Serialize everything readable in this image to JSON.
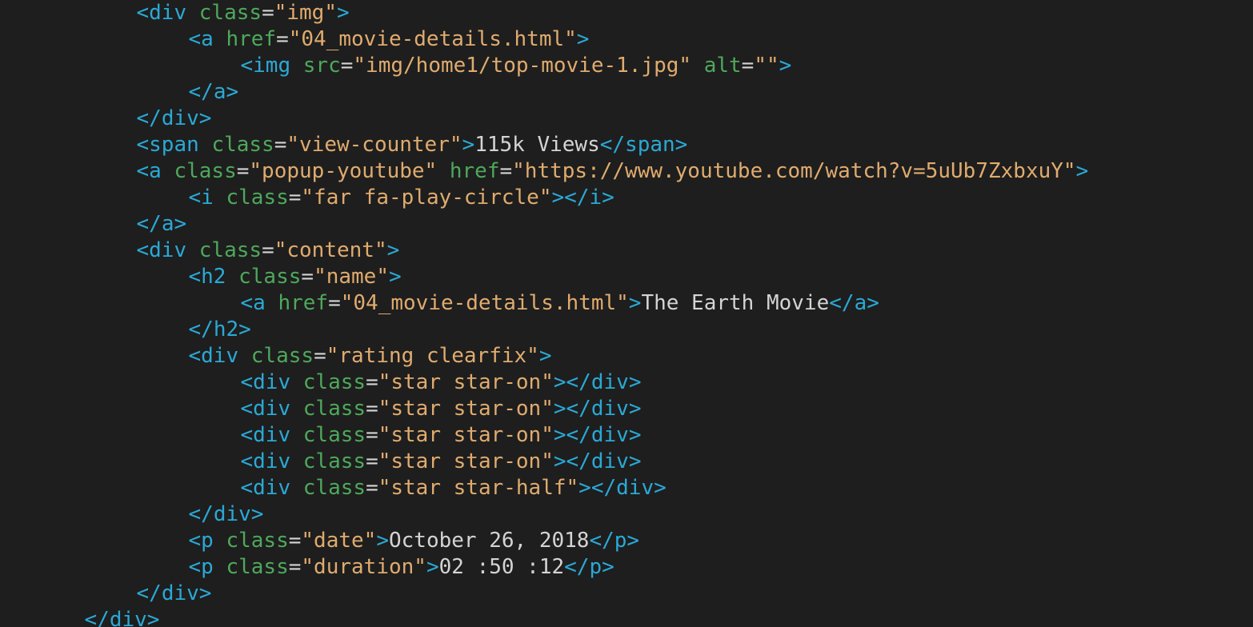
{
  "editor": {
    "lines": [
      {
        "indent": 5,
        "tokens": [
          {
            "t": "bracket",
            "v": "<"
          },
          {
            "t": "tag",
            "v": "div"
          },
          {
            "t": "text",
            "v": " "
          },
          {
            "t": "attr",
            "v": "class"
          },
          {
            "t": "eq",
            "v": "="
          },
          {
            "t": "str",
            "v": "\"img\""
          },
          {
            "t": "bracket",
            "v": ">"
          }
        ]
      },
      {
        "indent": 7,
        "tokens": [
          {
            "t": "bracket",
            "v": "<"
          },
          {
            "t": "tag",
            "v": "a"
          },
          {
            "t": "text",
            "v": " "
          },
          {
            "t": "attr",
            "v": "href"
          },
          {
            "t": "eq",
            "v": "="
          },
          {
            "t": "str",
            "v": "\"04_movie-details.html\""
          },
          {
            "t": "bracket",
            "v": ">"
          }
        ]
      },
      {
        "indent": 9,
        "tokens": [
          {
            "t": "bracket",
            "v": "<"
          },
          {
            "t": "tag",
            "v": "img"
          },
          {
            "t": "text",
            "v": " "
          },
          {
            "t": "attr",
            "v": "src"
          },
          {
            "t": "eq",
            "v": "="
          },
          {
            "t": "str",
            "v": "\"img/home1/top-movie-1.jpg\""
          },
          {
            "t": "text",
            "v": " "
          },
          {
            "t": "attr",
            "v": "alt"
          },
          {
            "t": "eq",
            "v": "="
          },
          {
            "t": "str",
            "v": "\"\""
          },
          {
            "t": "bracket",
            "v": ">"
          }
        ]
      },
      {
        "indent": 7,
        "tokens": [
          {
            "t": "bracket",
            "v": "</"
          },
          {
            "t": "tag",
            "v": "a"
          },
          {
            "t": "bracket",
            "v": ">"
          }
        ]
      },
      {
        "indent": 5,
        "tokens": [
          {
            "t": "bracket",
            "v": "</"
          },
          {
            "t": "tag",
            "v": "div"
          },
          {
            "t": "bracket",
            "v": ">"
          }
        ]
      },
      {
        "indent": 5,
        "tokens": [
          {
            "t": "bracket",
            "v": "<"
          },
          {
            "t": "tag",
            "v": "span"
          },
          {
            "t": "text",
            "v": " "
          },
          {
            "t": "attr",
            "v": "class"
          },
          {
            "t": "eq",
            "v": "="
          },
          {
            "t": "str",
            "v": "\"view-counter\""
          },
          {
            "t": "bracket",
            "v": ">"
          },
          {
            "t": "text",
            "v": "115k Views"
          },
          {
            "t": "bracket",
            "v": "</"
          },
          {
            "t": "tag",
            "v": "span"
          },
          {
            "t": "bracket",
            "v": ">"
          }
        ]
      },
      {
        "indent": 5,
        "tokens": [
          {
            "t": "bracket",
            "v": "<"
          },
          {
            "t": "tag",
            "v": "a"
          },
          {
            "t": "text",
            "v": " "
          },
          {
            "t": "attr",
            "v": "class"
          },
          {
            "t": "eq",
            "v": "="
          },
          {
            "t": "str",
            "v": "\"popup-youtube\""
          },
          {
            "t": "text",
            "v": " "
          },
          {
            "t": "attr",
            "v": "href"
          },
          {
            "t": "eq",
            "v": "="
          },
          {
            "t": "str",
            "v": "\"https://www.youtube.com/watch?v=5uUb7ZxbxuY\""
          },
          {
            "t": "bracket",
            "v": ">"
          }
        ]
      },
      {
        "indent": 7,
        "tokens": [
          {
            "t": "bracket",
            "v": "<"
          },
          {
            "t": "tag",
            "v": "i"
          },
          {
            "t": "text",
            "v": " "
          },
          {
            "t": "attr",
            "v": "class"
          },
          {
            "t": "eq",
            "v": "="
          },
          {
            "t": "str",
            "v": "\"far fa-play-circle\""
          },
          {
            "t": "bracket",
            "v": "></"
          },
          {
            "t": "tag",
            "v": "i"
          },
          {
            "t": "bracket",
            "v": ">"
          }
        ]
      },
      {
        "indent": 5,
        "tokens": [
          {
            "t": "bracket",
            "v": "</"
          },
          {
            "t": "tag",
            "v": "a"
          },
          {
            "t": "bracket",
            "v": ">"
          }
        ]
      },
      {
        "indent": 5,
        "tokens": [
          {
            "t": "bracket",
            "v": "<"
          },
          {
            "t": "tag",
            "v": "div"
          },
          {
            "t": "text",
            "v": " "
          },
          {
            "t": "attr",
            "v": "class"
          },
          {
            "t": "eq",
            "v": "="
          },
          {
            "t": "str",
            "v": "\"content\""
          },
          {
            "t": "bracket",
            "v": ">"
          }
        ]
      },
      {
        "indent": 7,
        "tokens": [
          {
            "t": "bracket",
            "v": "<"
          },
          {
            "t": "tag",
            "v": "h2"
          },
          {
            "t": "text",
            "v": " "
          },
          {
            "t": "attr",
            "v": "class"
          },
          {
            "t": "eq",
            "v": "="
          },
          {
            "t": "str",
            "v": "\"name\""
          },
          {
            "t": "bracket",
            "v": ">"
          }
        ]
      },
      {
        "indent": 9,
        "tokens": [
          {
            "t": "bracket",
            "v": "<"
          },
          {
            "t": "tag",
            "v": "a"
          },
          {
            "t": "text",
            "v": " "
          },
          {
            "t": "attr",
            "v": "href"
          },
          {
            "t": "eq",
            "v": "="
          },
          {
            "t": "str",
            "v": "\"04_movie-details.html\""
          },
          {
            "t": "bracket",
            "v": ">"
          },
          {
            "t": "text",
            "v": "The Earth Movie"
          },
          {
            "t": "bracket",
            "v": "</"
          },
          {
            "t": "tag",
            "v": "a"
          },
          {
            "t": "bracket",
            "v": ">"
          }
        ]
      },
      {
        "indent": 7,
        "tokens": [
          {
            "t": "bracket",
            "v": "</"
          },
          {
            "t": "tag",
            "v": "h2"
          },
          {
            "t": "bracket",
            "v": ">"
          }
        ]
      },
      {
        "indent": 7,
        "tokens": [
          {
            "t": "bracket",
            "v": "<"
          },
          {
            "t": "tag",
            "v": "div"
          },
          {
            "t": "text",
            "v": " "
          },
          {
            "t": "attr",
            "v": "class"
          },
          {
            "t": "eq",
            "v": "="
          },
          {
            "t": "str",
            "v": "\"rating clearfix\""
          },
          {
            "t": "bracket",
            "v": ">"
          }
        ]
      },
      {
        "indent": 9,
        "tokens": [
          {
            "t": "bracket",
            "v": "<"
          },
          {
            "t": "tag",
            "v": "div"
          },
          {
            "t": "text",
            "v": " "
          },
          {
            "t": "attr",
            "v": "class"
          },
          {
            "t": "eq",
            "v": "="
          },
          {
            "t": "str",
            "v": "\"star star-on\""
          },
          {
            "t": "bracket",
            "v": "></"
          },
          {
            "t": "tag",
            "v": "div"
          },
          {
            "t": "bracket",
            "v": ">"
          }
        ]
      },
      {
        "indent": 9,
        "tokens": [
          {
            "t": "bracket",
            "v": "<"
          },
          {
            "t": "tag",
            "v": "div"
          },
          {
            "t": "text",
            "v": " "
          },
          {
            "t": "attr",
            "v": "class"
          },
          {
            "t": "eq",
            "v": "="
          },
          {
            "t": "str",
            "v": "\"star star-on\""
          },
          {
            "t": "bracket",
            "v": "></"
          },
          {
            "t": "tag",
            "v": "div"
          },
          {
            "t": "bracket",
            "v": ">"
          }
        ]
      },
      {
        "indent": 9,
        "tokens": [
          {
            "t": "bracket",
            "v": "<"
          },
          {
            "t": "tag",
            "v": "div"
          },
          {
            "t": "text",
            "v": " "
          },
          {
            "t": "attr",
            "v": "class"
          },
          {
            "t": "eq",
            "v": "="
          },
          {
            "t": "str",
            "v": "\"star star-on\""
          },
          {
            "t": "bracket",
            "v": "></"
          },
          {
            "t": "tag",
            "v": "div"
          },
          {
            "t": "bracket",
            "v": ">"
          }
        ]
      },
      {
        "indent": 9,
        "tokens": [
          {
            "t": "bracket",
            "v": "<"
          },
          {
            "t": "tag",
            "v": "div"
          },
          {
            "t": "text",
            "v": " "
          },
          {
            "t": "attr",
            "v": "class"
          },
          {
            "t": "eq",
            "v": "="
          },
          {
            "t": "str",
            "v": "\"star star-on\""
          },
          {
            "t": "bracket",
            "v": "></"
          },
          {
            "t": "tag",
            "v": "div"
          },
          {
            "t": "bracket",
            "v": ">"
          }
        ]
      },
      {
        "indent": 9,
        "tokens": [
          {
            "t": "bracket",
            "v": "<"
          },
          {
            "t": "tag",
            "v": "div"
          },
          {
            "t": "text",
            "v": " "
          },
          {
            "t": "attr",
            "v": "class"
          },
          {
            "t": "eq",
            "v": "="
          },
          {
            "t": "str",
            "v": "\"star star-half\""
          },
          {
            "t": "bracket",
            "v": "></"
          },
          {
            "t": "tag",
            "v": "div"
          },
          {
            "t": "bracket",
            "v": ">"
          }
        ]
      },
      {
        "indent": 7,
        "tokens": [
          {
            "t": "bracket",
            "v": "</"
          },
          {
            "t": "tag",
            "v": "div"
          },
          {
            "t": "bracket",
            "v": ">"
          }
        ]
      },
      {
        "indent": 7,
        "tokens": [
          {
            "t": "bracket",
            "v": "<"
          },
          {
            "t": "tag",
            "v": "p"
          },
          {
            "t": "text",
            "v": " "
          },
          {
            "t": "attr",
            "v": "class"
          },
          {
            "t": "eq",
            "v": "="
          },
          {
            "t": "str",
            "v": "\"date\""
          },
          {
            "t": "bracket",
            "v": ">"
          },
          {
            "t": "text",
            "v": "October 26, 2018"
          },
          {
            "t": "bracket",
            "v": "</"
          },
          {
            "t": "tag",
            "v": "p"
          },
          {
            "t": "bracket",
            "v": ">"
          }
        ]
      },
      {
        "indent": 7,
        "tokens": [
          {
            "t": "bracket",
            "v": "<"
          },
          {
            "t": "tag",
            "v": "p"
          },
          {
            "t": "text",
            "v": " "
          },
          {
            "t": "attr",
            "v": "class"
          },
          {
            "t": "eq",
            "v": "="
          },
          {
            "t": "str",
            "v": "\"duration\""
          },
          {
            "t": "bracket",
            "v": ">"
          },
          {
            "t": "text",
            "v": "02 :50 :12"
          },
          {
            "t": "bracket",
            "v": "</"
          },
          {
            "t": "tag",
            "v": "p"
          },
          {
            "t": "bracket",
            "v": ">"
          }
        ]
      },
      {
        "indent": 5,
        "tokens": [
          {
            "t": "bracket",
            "v": "</"
          },
          {
            "t": "tag",
            "v": "div"
          },
          {
            "t": "bracket",
            "v": ">"
          }
        ]
      },
      {
        "indent": 3,
        "tokens": [
          {
            "t": "bracket",
            "v": "</"
          },
          {
            "t": "tag",
            "v": "div"
          },
          {
            "t": "bracket",
            "v": ">"
          }
        ]
      }
    ]
  },
  "colors": {
    "background": "#1e1e1e",
    "tag": "#2aa9d6",
    "attribute": "#4ea85b",
    "string": "#e0ab6e",
    "text": "#d4d4d4"
  }
}
